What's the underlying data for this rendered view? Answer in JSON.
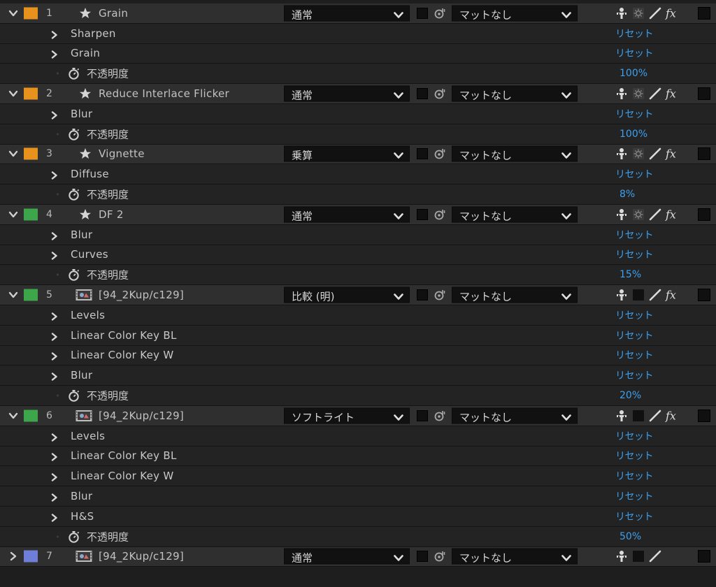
{
  "colors": {
    "orange": "#e8921e",
    "green": "#3ea64a",
    "blue": "#6f7fd8",
    "accent_blue": "#3ea0ee"
  },
  "icons": {
    "expand": "chevron-down-icon",
    "collapse": "chevron-right-icon",
    "effect_layer": "star-icon",
    "footage_layer": "footage-icon",
    "opacity": "stopwatch-icon",
    "shy": "shy-icon",
    "collapse_transform": "collapse-transform-icon",
    "quality": "quality-slash-icon",
    "fx": "fx-icon"
  },
  "switches": {
    "fx_label": "fx"
  },
  "layers": [
    {
      "num": "1",
      "name": "Grain",
      "color": "#e8921e",
      "kind": "effect",
      "expanded": true,
      "mode": "通常",
      "matte": "マットなし",
      "collapse_switch": true,
      "fx": true,
      "props": [
        {
          "type": "effect",
          "name": "Sharpen",
          "value": "リセット"
        },
        {
          "type": "effect",
          "name": "Grain",
          "value": "リセット"
        },
        {
          "type": "opacity",
          "name": "不透明度",
          "value": "100%"
        }
      ]
    },
    {
      "num": "2",
      "name": "Reduce Interlace Flicker",
      "color": "#e8921e",
      "kind": "effect",
      "expanded": true,
      "mode": "通常",
      "matte": "マットなし",
      "collapse_switch": true,
      "fx": true,
      "props": [
        {
          "type": "effect",
          "name": "Blur",
          "value": "リセット"
        },
        {
          "type": "opacity",
          "name": "不透明度",
          "value": "100%"
        }
      ]
    },
    {
      "num": "3",
      "name": "Vignette",
      "color": "#e8921e",
      "kind": "effect",
      "expanded": true,
      "mode": "乗算",
      "matte": "マットなし",
      "collapse_switch": true,
      "fx": true,
      "props": [
        {
          "type": "effect",
          "name": "Diffuse",
          "value": "リセット"
        },
        {
          "type": "opacity",
          "name": "不透明度",
          "value": "8%"
        }
      ]
    },
    {
      "num": "4",
      "name": "DF 2",
      "color": "#3ea64a",
      "kind": "effect",
      "expanded": true,
      "mode": "通常",
      "matte": "マットなし",
      "collapse_switch": true,
      "fx": true,
      "props": [
        {
          "type": "effect",
          "name": "Blur",
          "value": "リセット"
        },
        {
          "type": "effect",
          "name": "Curves",
          "value": "リセット"
        },
        {
          "type": "opacity",
          "name": "不透明度",
          "value": "15%"
        }
      ]
    },
    {
      "num": "5",
      "name": "[94_2Kup/c129]",
      "color": "#3ea64a",
      "kind": "footage",
      "expanded": true,
      "mode": "比較 (明)",
      "matte": "マットなし",
      "collapse_switch": false,
      "fx": true,
      "props": [
        {
          "type": "effect",
          "name": "Levels",
          "value": "リセット"
        },
        {
          "type": "effect",
          "name": "Linear Color Key BL",
          "value": "リセット"
        },
        {
          "type": "effect",
          "name": "Linear Color Key W",
          "value": "リセット"
        },
        {
          "type": "effect",
          "name": "Blur",
          "value": "リセット"
        },
        {
          "type": "opacity",
          "name": "不透明度",
          "value": "20%"
        }
      ]
    },
    {
      "num": "6",
      "name": "[94_2Kup/c129]",
      "color": "#3ea64a",
      "kind": "footage",
      "expanded": true,
      "mode": "ソフトライト",
      "matte": "マットなし",
      "collapse_switch": false,
      "fx": true,
      "props": [
        {
          "type": "effect",
          "name": "Levels",
          "value": "リセット"
        },
        {
          "type": "effect",
          "name": "Linear Color Key BL",
          "value": "リセット"
        },
        {
          "type": "effect",
          "name": "Linear Color Key W",
          "value": "リセット"
        },
        {
          "type": "effect",
          "name": "Blur",
          "value": "リセット"
        },
        {
          "type": "effect",
          "name": "H&S",
          "value": "リセット"
        },
        {
          "type": "opacity",
          "name": "不透明度",
          "value": "50%"
        }
      ]
    },
    {
      "num": "7",
      "name": "[94_2Kup/c129]",
      "color": "#6f7fd8",
      "kind": "footage",
      "expanded": false,
      "mode": "通常",
      "matte": "マットなし",
      "collapse_switch": false,
      "fx": false,
      "props": []
    }
  ]
}
